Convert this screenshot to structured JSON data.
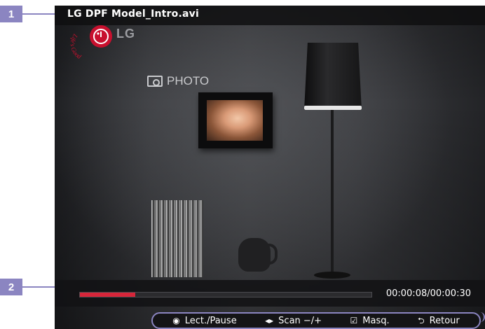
{
  "callouts": {
    "first": "1",
    "second": "2"
  },
  "video": {
    "title": "LG DPF Model_Intro.avi",
    "brand": "LG",
    "slogan": "Life's Good",
    "photo_label": "PHOTO"
  },
  "playback": {
    "time": "00:00:08/00:00:30",
    "progress_fraction": 0.19
  },
  "controls": [
    {
      "icon": "record-circle-icon",
      "label": "Lect./Pause"
    },
    {
      "icon": "left-right-arrows-icon",
      "label": "Scan −/+"
    },
    {
      "icon": "checkbox-icon",
      "label": "Masq."
    },
    {
      "icon": "return-arrow-icon",
      "label": "Retour"
    }
  ],
  "colors": {
    "callout": "#8b85c1",
    "progress": "#d7263a",
    "lg_red": "#c8102e"
  }
}
